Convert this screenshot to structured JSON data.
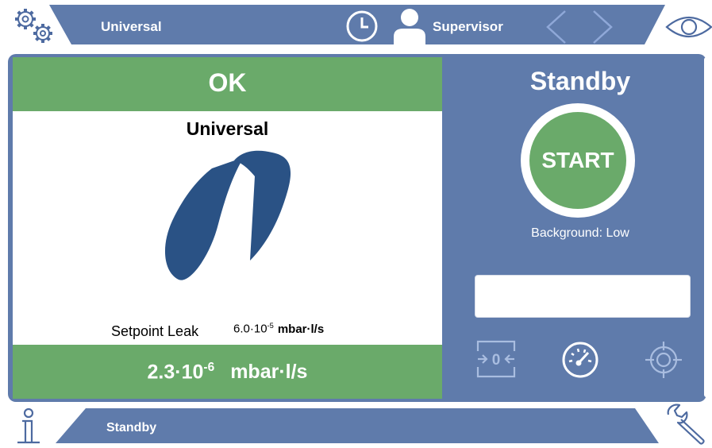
{
  "colors": {
    "panel_blue": "#5f7bab",
    "accent_green": "#6aaa6a",
    "logo_blue": "#2a5285",
    "white": "#ffffff"
  },
  "top_bar": {
    "settings_icon": "gears-icon",
    "mode_label": "Universal",
    "clock_icon": "clock-icon",
    "user_icon": "user-icon",
    "user_label": "Supervisor",
    "prev_icon": "chevron-left-icon",
    "next_icon": "chevron-right-icon",
    "view_icon": "eye-icon"
  },
  "measurement_card": {
    "status": "OK",
    "mode_title": "Universal",
    "logo": "inficon-logo",
    "setpoint_label": "Setpoint Leak",
    "setpoint_mantissa": "6.0·10",
    "setpoint_exponent": "-5",
    "setpoint_unit": "mbar·l/s",
    "leak_mantissa": "2.3·10",
    "leak_exponent": "-6",
    "leak_unit": "mbar·l/s"
  },
  "control_panel": {
    "state": "Standby",
    "start_label": "START",
    "background_text": "Background: Low",
    "message_box": "",
    "zero_icon": "zero-icon",
    "gauge_icon": "gauge-icon",
    "crosshair_icon": "crosshair-icon"
  },
  "bottom_bar": {
    "info_icon": "info-icon",
    "status_text": "Standby",
    "wrench_icon": "wrench-icon"
  }
}
